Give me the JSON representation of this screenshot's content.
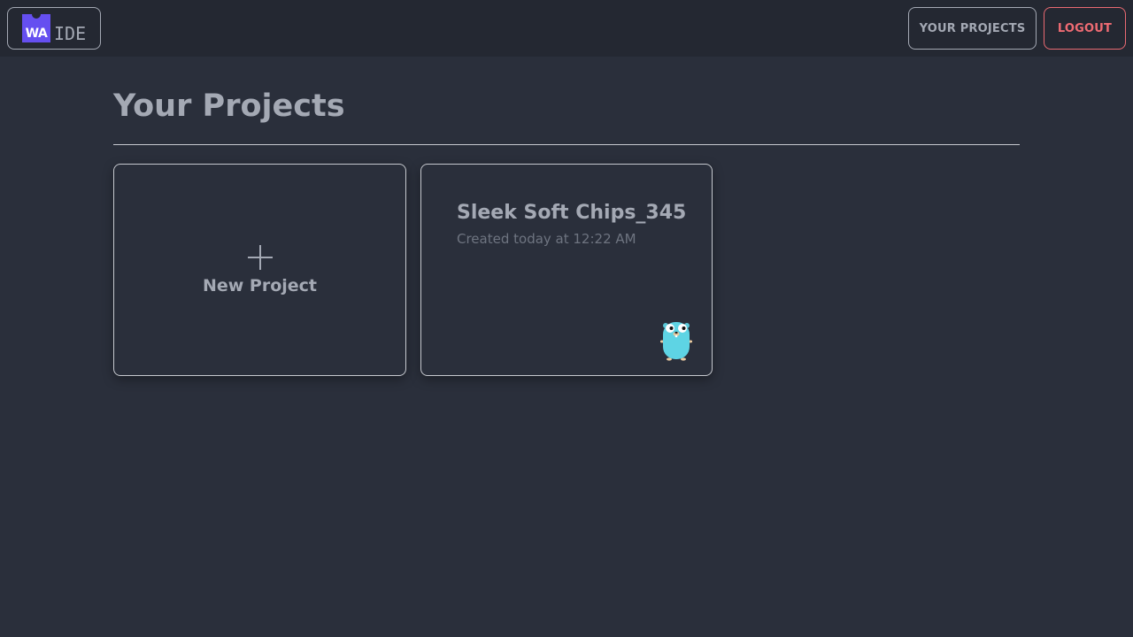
{
  "header": {
    "logo_mark": "WA",
    "logo_text": "IDE",
    "your_projects_label": "YOUR PROJECTS",
    "logout_label": "LOGOUT"
  },
  "main": {
    "title": "Your Projects",
    "new_project_label": "New Project",
    "projects": [
      {
        "name": "Sleek Soft Chips_345",
        "created": "Created today at 12:22 AM",
        "language_icon": "gopher-icon"
      }
    ]
  },
  "colors": {
    "background": "#2a2f3b",
    "header_background": "#242832",
    "accent": "#654ff0",
    "logout": "#ef6b73",
    "text": "#a4a9b4"
  }
}
